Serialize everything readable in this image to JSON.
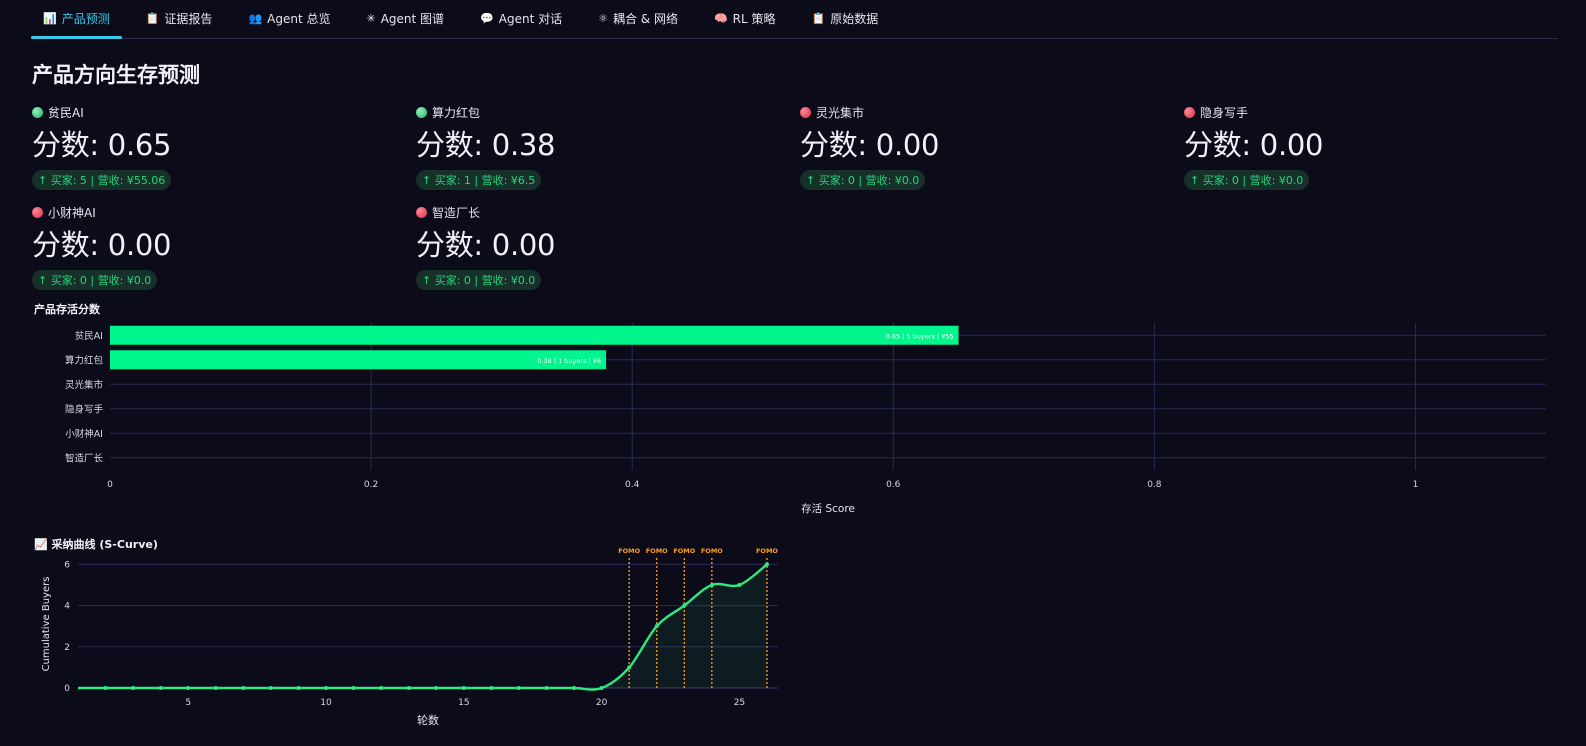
{
  "tabs": [
    {
      "icon": "📊",
      "icon_name": "bar-chart-icon",
      "label": "产品预测",
      "active": true
    },
    {
      "icon": "📋",
      "icon_name": "clipboard-icon",
      "label": "证据报告",
      "active": false
    },
    {
      "icon": "👥",
      "icon_name": "agents-icon",
      "label": "Agent 总览",
      "active": false
    },
    {
      "icon": "✳",
      "icon_name": "graph-icon",
      "label": "Agent 图谱",
      "active": false
    },
    {
      "icon": "💬",
      "icon_name": "chat-icon",
      "label": "Agent 对话",
      "active": false
    },
    {
      "icon": "⚛",
      "icon_name": "network-icon",
      "label": "耦合 & 网络",
      "active": false
    },
    {
      "icon": "🧠",
      "icon_name": "brain-icon",
      "label": "RL 策略",
      "active": false
    },
    {
      "icon": "📋",
      "icon_name": "clipboard-icon",
      "label": "原始数据",
      "active": false
    }
  ],
  "page_title": "产品方向生存预测",
  "metrics": [
    {
      "label": "贫民AI",
      "status": "green",
      "value": "分数: 0.65",
      "delta": "↑ 买家: 5 | 营收: ¥55.06"
    },
    {
      "label": "算力红包",
      "status": "green",
      "value": "分数: 0.38",
      "delta": "↑ 买家: 1 | 营收: ¥6.5"
    },
    {
      "label": "灵光集市",
      "status": "red",
      "value": "分数: 0.00",
      "delta": "↑ 买家: 0 | 营收: ¥0.0"
    },
    {
      "label": "隐身写手",
      "status": "red",
      "value": "分数: 0.00",
      "delta": "↑ 买家: 0 | 营收: ¥0.0"
    },
    {
      "label": "小财神AI",
      "status": "red",
      "value": "分数: 0.00",
      "delta": "↑ 买家: 0 | 营收: ¥0.0"
    },
    {
      "label": "智造厂长",
      "status": "red",
      "value": "分数: 0.00",
      "delta": "↑ 买家: 0 | 营收: ¥0.0"
    }
  ],
  "colors": {
    "accent": "#3cc8e8",
    "bar": "#00f58c",
    "line": "#2ee882",
    "fomo": "#ff9f1a",
    "positive": "#21d67b",
    "negative": "#d62a45"
  },
  "chart_data": [
    {
      "type": "bar",
      "orientation": "horizontal",
      "title": "产品存活分数",
      "categories": [
        "贫民AI",
        "算力红包",
        "灵光集市",
        "隐身写手",
        "小财神AI",
        "智造厂长"
      ],
      "values": [
        0.65,
        0.38,
        0,
        0,
        0,
        0
      ],
      "data_labels": [
        "0.65 | 5 buyers | ¥55",
        "0.38 | 1 buyers | ¥6",
        "",
        "",
        "",
        ""
      ],
      "xlabel": "存活 Score",
      "ylabel": "",
      "xlim": [
        0,
        1.1
      ],
      "xticks": [
        0,
        0.2,
        0.4,
        0.6,
        0.8,
        1
      ],
      "xtick_labels": [
        "0",
        "0.2",
        "0.4",
        "0.6",
        "0.8",
        "1"
      ],
      "grid": true
    },
    {
      "type": "area",
      "title": "📈 采纳曲线 (S-Curve)",
      "xlabel": "轮数",
      "ylabel": "Cumulative Buyers",
      "x": [
        1,
        2,
        3,
        4,
        5,
        6,
        7,
        8,
        9,
        10,
        11,
        12,
        13,
        14,
        15,
        16,
        17,
        18,
        19,
        20,
        21,
        22,
        23,
        24,
        25,
        26
      ],
      "y": [
        0,
        0,
        0,
        0,
        0,
        0,
        0,
        0,
        0,
        0,
        0,
        0,
        0,
        0,
        0,
        0,
        0,
        0,
        0,
        0,
        1,
        3,
        4,
        5,
        5,
        6
      ],
      "markers_from_x": 2,
      "xlim": [
        1,
        26.4
      ],
      "ylim": [
        0,
        6.6
      ],
      "xticks": [
        5,
        10,
        15,
        20,
        25
      ],
      "xtick_labels": [
        "5",
        "10",
        "15",
        "20",
        "25"
      ],
      "yticks": [
        0,
        2,
        4,
        6
      ],
      "ytick_labels": [
        "0",
        "2",
        "4",
        "6"
      ],
      "annotations": [
        {
          "x": 21,
          "text": "FOMO"
        },
        {
          "x": 22,
          "text": "FOMO"
        },
        {
          "x": 23,
          "text": "FOMO"
        },
        {
          "x": 24,
          "text": "FOMO"
        },
        {
          "x": 26,
          "text": "FOMO"
        }
      ],
      "grid": true
    }
  ]
}
